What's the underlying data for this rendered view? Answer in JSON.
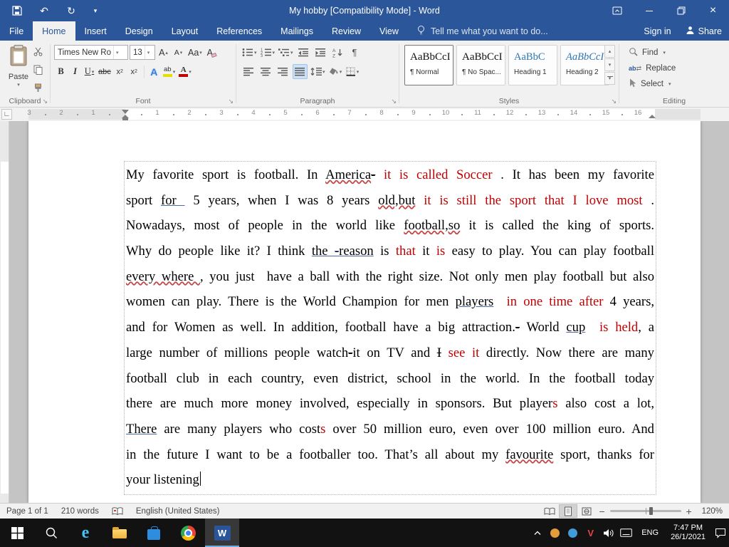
{
  "titlebar": {
    "title": "My hobby [Compatibility Mode] - Word"
  },
  "tabs": [
    {
      "label": "File",
      "active": false
    },
    {
      "label": "Home",
      "active": true
    },
    {
      "label": "Insert",
      "active": false
    },
    {
      "label": "Design",
      "active": false
    },
    {
      "label": "Layout",
      "active": false
    },
    {
      "label": "References",
      "active": false
    },
    {
      "label": "Mailings",
      "active": false
    },
    {
      "label": "Review",
      "active": false
    },
    {
      "label": "View",
      "active": false
    }
  ],
  "tellme": {
    "label": "Tell me what you want to do...",
    "icon": "lightbulb"
  },
  "account": {
    "signin": "Sign in",
    "share": "Share",
    "share_icon": "person"
  },
  "ribbon": {
    "clipboard": {
      "paste": "Paste",
      "label": "Clipboard",
      "icons": [
        "paste-clipboard",
        "cut",
        "copy",
        "format-painter"
      ]
    },
    "font": {
      "name": "Times New Ro",
      "size": "13",
      "label": "Font",
      "icons": [
        "grow-font",
        "shrink-font",
        "change-case",
        "clear-formatting",
        "bold",
        "italic",
        "underline",
        "strikethrough",
        "subscript",
        "superscript",
        "text-effects",
        "highlight-color",
        "font-color"
      ],
      "highlight_color": "#e3e000",
      "font_color": "#c00000"
    },
    "paragraph": {
      "label": "Paragraph",
      "icons": [
        "bullets",
        "numbering",
        "multilevel-list",
        "decrease-indent",
        "increase-indent",
        "sort",
        "show-hide",
        "align-left",
        "align-center",
        "align-right",
        "justify",
        "line-spacing",
        "shading",
        "borders"
      ]
    },
    "styles": {
      "label": "Styles",
      "items": [
        {
          "key": "normal",
          "preview": "AaBbCcI",
          "label": "¶ Normal",
          "selected": true
        },
        {
          "key": "nospace",
          "preview": "AaBbCcI",
          "label": "¶ No Spac...",
          "selected": false
        },
        {
          "key": "h1",
          "preview": "AaBbC",
          "label": "Heading 1",
          "selected": false
        },
        {
          "key": "h2",
          "preview": "AaBbCcI",
          "label": "Heading 2",
          "selected": false
        }
      ]
    },
    "editing": {
      "label": "Editing",
      "find": "Find",
      "replace": "Replace",
      "select": "Select"
    }
  },
  "ruler": {
    "left": [
      "3",
      "2",
      "1"
    ],
    "right": [
      "1",
      "2",
      "3",
      "4",
      "5",
      "6",
      "7",
      "8",
      "9",
      "10",
      "11",
      "12",
      "13",
      "14",
      "15",
      "16"
    ]
  },
  "document": {
    "lines": [
      [
        {
          "t": "My favorite sport is football. In "
        },
        {
          "t": "America",
          "u": 1
        },
        {
          "t": "-",
          "s": 1
        },
        {
          "t": " "
        },
        {
          "t": "it is called Soccer ",
          "c": "r"
        },
        {
          "t": ". It has been my favorite"
        }
      ],
      [
        {
          "t": "sport "
        },
        {
          "t": "for ",
          "u": 2
        },
        {
          "t": " 5 years, when I was 8 years "
        },
        {
          "t": "old,but",
          "u": 1
        },
        {
          "t": " "
        },
        {
          "t": "it is still the sport that I love most ",
          "c": "r"
        },
        {
          "t": "."
        }
      ],
      [
        {
          "t": "Nowadays, most of people in the world like "
        },
        {
          "t": "football,so",
          "u": 1
        },
        {
          "t": " it is called the king of sports."
        }
      ],
      [
        {
          "t": "Why do people like it? I think "
        },
        {
          "t": "the ",
          "u": 2
        },
        {
          "t": "-",
          "u": 2,
          "s": 1
        },
        {
          "t": "reason",
          "u": 2
        },
        {
          "t": " is "
        },
        {
          "t": "that",
          "c": "r"
        },
        {
          "t": " it "
        },
        {
          "t": "is",
          "c": "r"
        },
        {
          "t": " easy to play. You can play football"
        }
      ],
      [
        {
          "t": "every where ",
          "u": 1
        },
        {
          "t": ", you just  have a ball with the right size. Not only men play football but also"
        }
      ],
      [
        {
          "t": "women can play. There is the World Champion for men "
        },
        {
          "t": "players",
          "u": 2
        },
        {
          "t": "  "
        },
        {
          "t": "in one time after",
          "c": "r"
        },
        {
          "t": " 4 years,"
        }
      ],
      [
        {
          "t": "and for Women as well. In addition, football have a big attraction."
        },
        {
          "t": "-",
          "s": 1
        },
        {
          "t": " World "
        },
        {
          "t": "cup",
          "u": 2
        },
        {
          "t": "  "
        },
        {
          "t": "is held",
          "c": "r"
        },
        {
          "t": ", a"
        }
      ],
      [
        {
          "t": "large number of millions people watch"
        },
        {
          "t": "-",
          "s": 1
        },
        {
          "t": "it on TV and "
        },
        {
          "t": "I",
          "s": 1
        },
        {
          "t": " "
        },
        {
          "t": "see it",
          "c": "r"
        },
        {
          "t": " directly. Now there are many"
        }
      ],
      [
        {
          "t": "football club in each country, even district, school in the world. In the football today"
        }
      ],
      [
        {
          "t": "there are much more money involved, especially in sponsors. But player"
        },
        {
          "t": "s",
          "c": "r"
        },
        {
          "t": " also cost a lot,"
        }
      ],
      [
        {
          "t": "There",
          "u": 2
        },
        {
          "t": " are many players who cost"
        },
        {
          "t": "s",
          "c": "r"
        },
        {
          "t": " over 50 million euro, even over 100 million euro. And"
        }
      ],
      [
        {
          "t": "in the future I want to be a footballer too. That’s all about my "
        },
        {
          "t": "favourite",
          "u": 1
        },
        {
          "t": " sport, thanks for"
        }
      ],
      [
        {
          "t": "your listening"
        }
      ]
    ]
  },
  "statusbar": {
    "page": "Page 1 of 1",
    "words": "210 words",
    "language": "English (United States)",
    "zoom": "120%",
    "view_icons": [
      "read-mode",
      "print-layout",
      "web-layout"
    ]
  },
  "taskbar": {
    "lang": "ENG",
    "time": "7:47 PM",
    "date": "26/1/2021",
    "icons": [
      "start",
      "search",
      "edge",
      "file-explorer",
      "store",
      "chrome",
      "word"
    ],
    "tray_icons": [
      "hidden-icons",
      "tray-orange",
      "tray-blue",
      "tray-red",
      "volume",
      "touch-keyboard",
      "action-center"
    ]
  }
}
